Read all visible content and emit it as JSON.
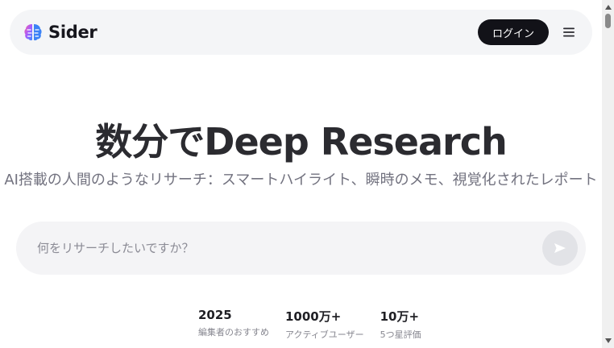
{
  "header": {
    "brand_name": "Sider",
    "login_label": "ログイン"
  },
  "hero": {
    "title": "数分でDeep Research",
    "subtitle": "AI搭載の人間のようなリサーチ：スマートハイライト、瞬時のメモ、視覚化されたレポート"
  },
  "search": {
    "placeholder": "何をリサーチしたいですか？",
    "value": ""
  },
  "stats": [
    {
      "value": "2025",
      "label": "編集者のおすすめ"
    },
    {
      "value": "1000万+",
      "label": "アクティブユーザー"
    },
    {
      "value": "10万+",
      "label": "5つ星評価"
    }
  ],
  "icons": {
    "logo": "brain-logo-icon",
    "menu": "hamburger-menu-icon",
    "send": "send-arrow-icon"
  },
  "colors": {
    "header_bg": "#f4f5f7",
    "login_bg": "#121218",
    "search_bg": "#f4f4f6",
    "send_bg": "#e2e3e7"
  }
}
